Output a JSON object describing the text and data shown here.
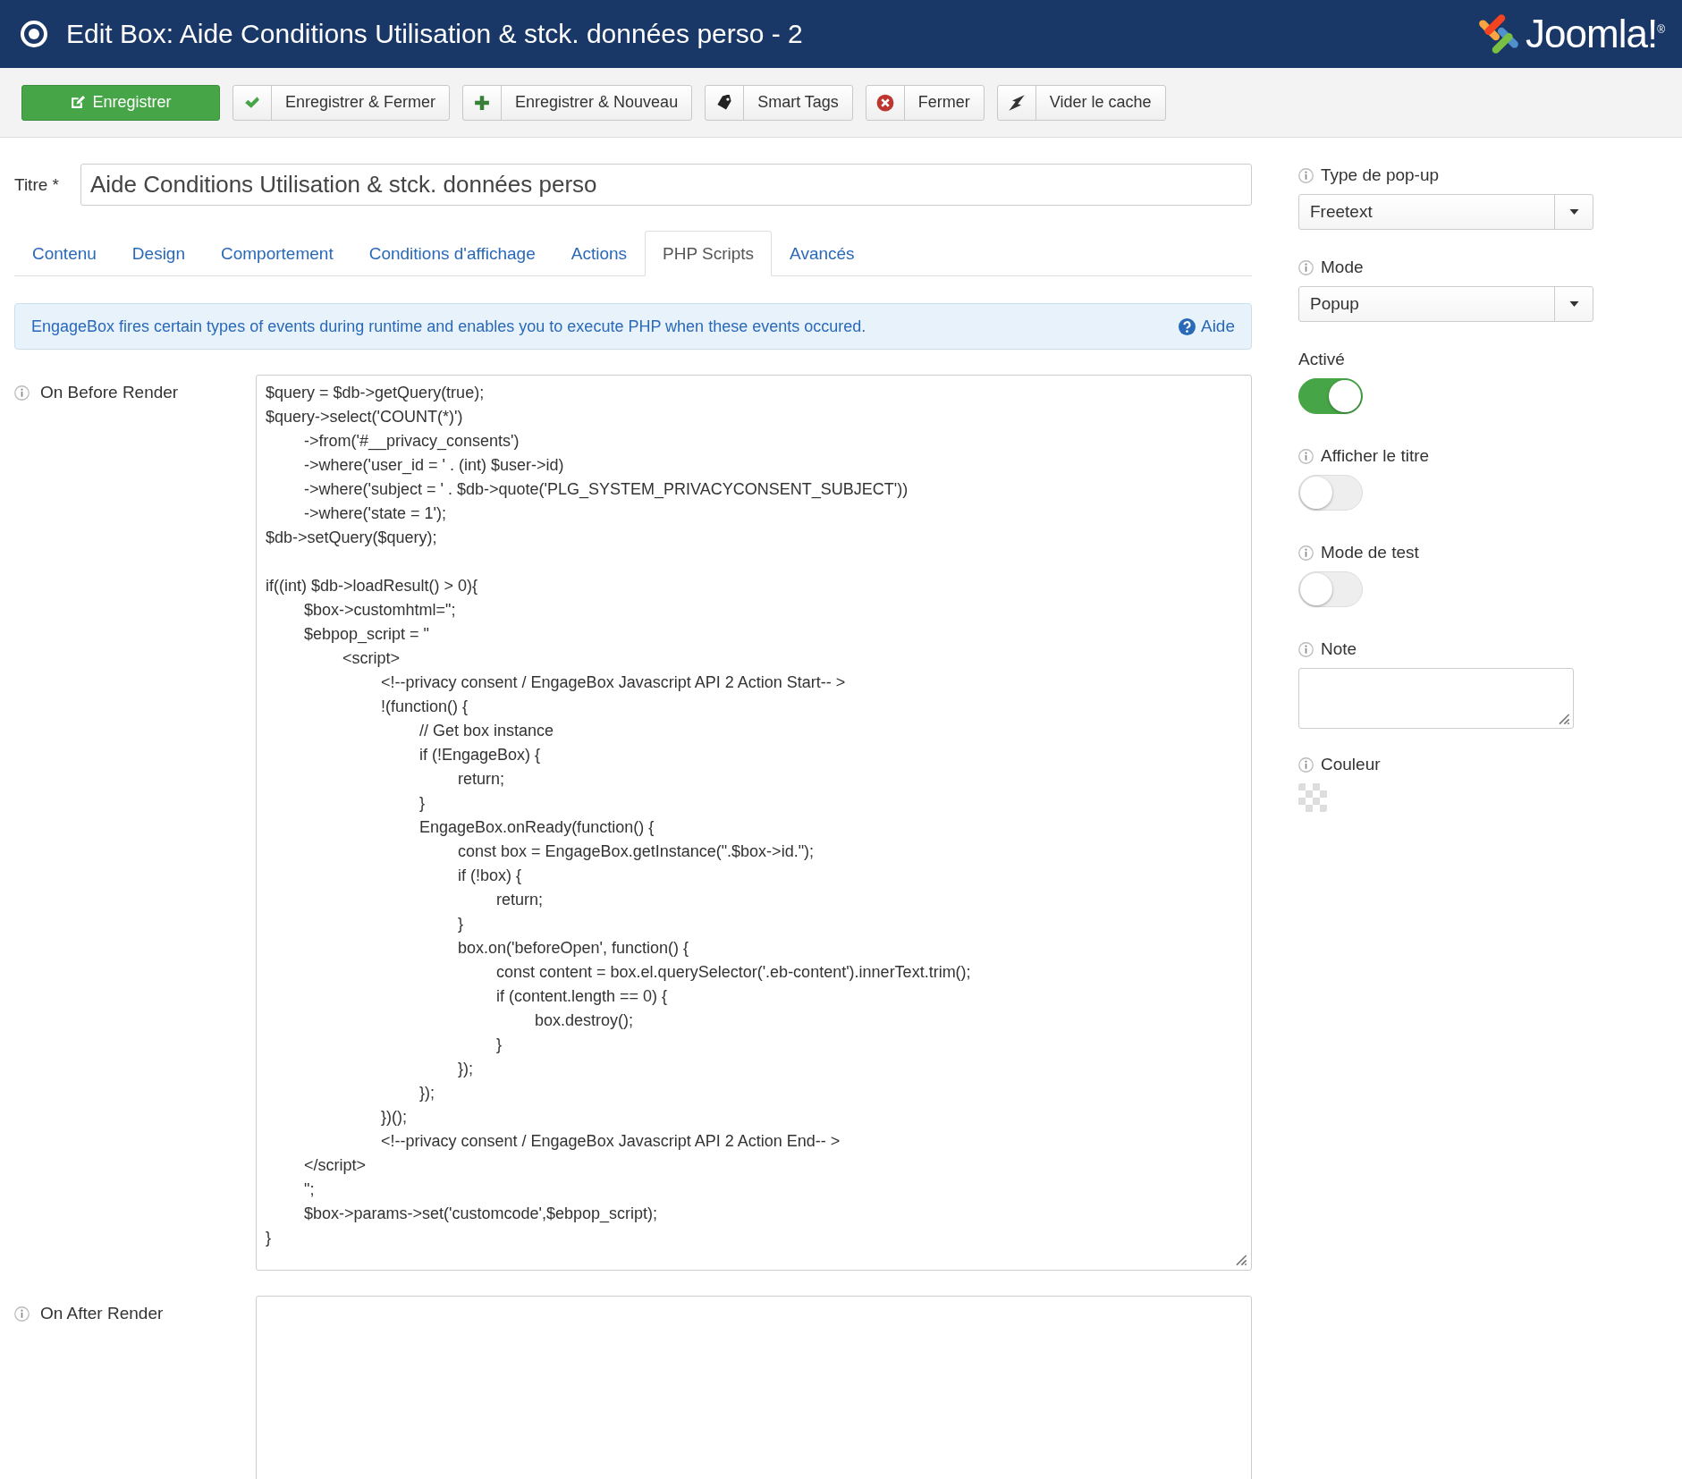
{
  "header": {
    "title": "Edit Box: Aide Conditions Utilisation & stck. données perso - 2",
    "logo_text": "Joomla!$^{®}$"
  },
  "toolbar": [
    {
      "label": "Enregistrer",
      "kind": "save"
    },
    {
      "label": "Enregistrer & Fermer",
      "kind": "check"
    },
    {
      "label": "Enregistrer & Nouveau",
      "kind": "plus"
    },
    {
      "label": "Smart Tags",
      "kind": "tag"
    },
    {
      "label": "Fermer",
      "kind": "close"
    },
    {
      "label": "Vider le cache",
      "kind": "clear"
    }
  ],
  "title_field": {
    "label": "Titre *",
    "value": "Aide Conditions Utilisation & stck. données perso"
  },
  "tabs": [
    {
      "label": "Contenu",
      "selected": false
    },
    {
      "label": "Design",
      "selected": false
    },
    {
      "label": "Comportement",
      "selected": false
    },
    {
      "label": "Conditions d'affichage",
      "selected": false
    },
    {
      "label": "Actions",
      "selected": false
    },
    {
      "label": "PHP Scripts",
      "selected": true
    },
    {
      "label": "Avancés",
      "selected": false
    }
  ],
  "alert": {
    "text": "EngageBox fires certain types of events during runtime and enables you to execute PHP when these events occured.",
    "help_link": "Aide"
  },
  "script_fields": [
    {
      "label": "On Before Render",
      "value": "$query = $db->getQuery(true);\n$query->select('COUNT(*)')\n\t->from('#__privacy_consents')\n\t->where('user_id = ' . (int) $user->id)\n\t->where('subject = ' . $db->quote('PLG_SYSTEM_PRIVACYCONSENT_SUBJECT'))\n\t->where('state = 1');\n$db->setQuery($query);\n\nif((int) $db->loadResult() > 0){\n\t$box->customhtml=\";\n\t$ebpop_script = \"\n\t\t<script>\n\t\t\t<!--privacy consent / EngageBox Javascript API 2 Action Start-- >\n\t\t\t!(function() {\n\t\t\t\t// Get box instance\n\t\t\t\tif (!EngageBox) {\n\t\t\t\t\treturn;\n\t\t\t\t}\n\t\t\t\tEngageBox.onReady(function() {\n\t\t\t\t\tconst box = EngageBox.getInstance(\".$box->id.\");\n\t\t\t\t\tif (!box) {\n\t\t\t\t\t\treturn;\n\t\t\t\t\t}\n\t\t\t\t\tbox.on('beforeOpen', function() {\n\t\t\t\t\t\tconst content = box.el.querySelector('.eb-content').innerText.trim();\n\t\t\t\t\t\tif (content.length == 0) {\n\t\t\t\t\t\t\tbox.destroy();\n\t\t\t\t\t\t}\n\t\t\t\t\t});\n\t\t\t\t});\n\t\t\t})();\n\t\t\t<!--privacy consent / EngageBox Javascript API 2 Action End-- >\n\t</script>\n\t\";\n\t$box->params->set('customcode',$ebpop_script);\n}"
    },
    {
      "label": "On After Render"
    }
  ],
  "sidebar": [
    {
      "kind": "select",
      "label": "Type de pop-up",
      "info": true,
      "value": "Freetext"
    },
    {
      "kind": "select",
      "label": "Mode",
      "info": true,
      "value": "Popup"
    },
    {
      "kind": "toggle",
      "label": "Activé",
      "info": false,
      "on": true
    },
    {
      "kind": "toggle",
      "label": "Afficher le titre",
      "info": true,
      "on": false
    },
    {
      "kind": "toggle",
      "label": "Mode de test",
      "info": true,
      "on": false
    },
    {
      "kind": "textarea",
      "label": "Note",
      "info": true
    },
    {
      "kind": "color",
      "label": "Couleur",
      "info": true
    }
  ]
}
